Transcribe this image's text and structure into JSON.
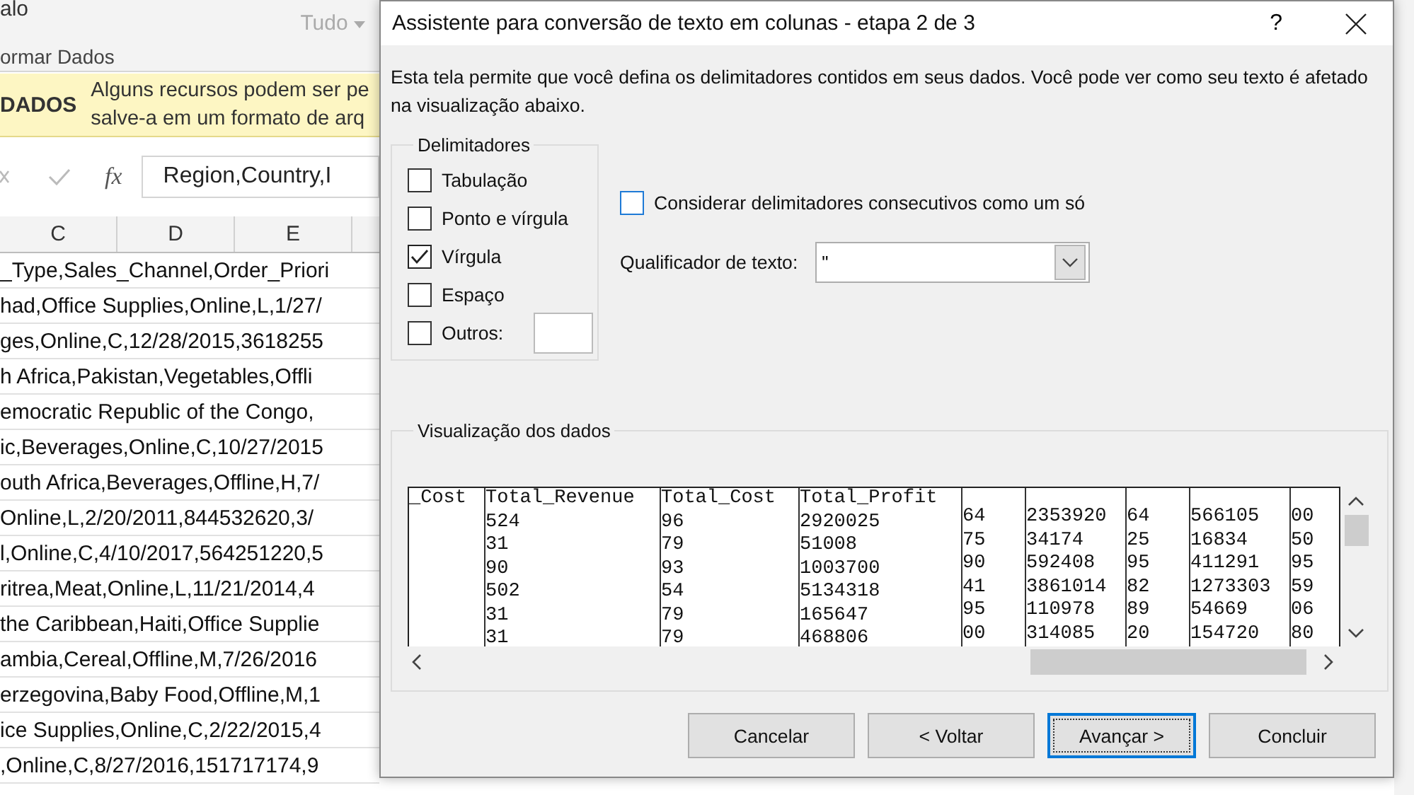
{
  "excel": {
    "ribbon": {
      "command": "alo",
      "refresh_button": "Tudo",
      "refresh_disabled": true,
      "group_label": "ormar Dados"
    },
    "message_bar": {
      "title": "DADOS",
      "lines": [
        "Alguns recursos podem ser pe",
        "salve-a em um formato de arq"
      ]
    },
    "formula_bar": {
      "fx": "fx",
      "value": "Region,Country,I"
    },
    "column_headers": [
      "C",
      "D",
      "E"
    ],
    "rows": [
      "_Type,Sales_Channel,Order_Priori",
      "had,Office Supplies,Online,L,1/27/",
      "ges,Online,C,12/28/2015,3618255",
      "h Africa,Pakistan,Vegetables,Offli",
      "emocratic Republic of the Congo,",
      "ic,Beverages,Online,C,10/27/2015",
      "outh Africa,Beverages,Offline,H,7/",
      "Online,L,2/20/2011,844532620,3/",
      "l,Online,C,4/10/2017,564251220,5",
      "ritrea,Meat,Online,L,11/21/2014,4",
      "the Caribbean,Haiti,Office Supplie",
      "ambia,Cereal,Offline,M,7/26/2016",
      "erzegovina,Baby Food,Offline,M,1",
      "ice Supplies,Online,C,2/22/2015,4",
      ",Online,C,8/27/2016,151717174,9"
    ]
  },
  "dialog": {
    "title": "Assistente para conversão de texto em colunas - etapa 2 de 3",
    "help": "?",
    "description": "Esta tela permite que você defina os delimitadores contidos em seus dados. Você pode ver como seu texto é afetado na visualização abaixo.",
    "delimiters": {
      "title": "Delimitadores",
      "options": [
        {
          "label": "Tabulação",
          "checked": false
        },
        {
          "label": "Ponto e vírgula",
          "checked": false
        },
        {
          "label": "Vírgula",
          "checked": true
        },
        {
          "label": "Espaço",
          "checked": false
        },
        {
          "label": "Outros:",
          "checked": false
        }
      ]
    },
    "consecutive": {
      "label": "Considerar delimitadores consecutivos como um só",
      "checked": false
    },
    "qualifier": {
      "label": "Qualificador de texto:",
      "value": "\""
    },
    "preview": {
      "title": "Visualização dos dados",
      "columns": [
        {
          "header": "_Cost"
        },
        {
          "header": "Total_Revenue",
          "cells": [
            "524",
            "31",
            "90",
            "502",
            "31",
            "31"
          ]
        },
        {
          "header": "Total_Cost",
          "cells": [
            "96",
            "79",
            "93",
            "54",
            "79",
            "79"
          ]
        },
        {
          "header": "Total_Profit",
          "cells": [
            "2920025",
            "51008",
            "1003700",
            "5134318",
            "165647",
            "468806"
          ]
        },
        {
          "cells": [
            "64",
            "75",
            "90",
            "41",
            "95",
            "00"
          ]
        },
        {
          "cells": [
            "2353920",
            "34174",
            "592408",
            "3861014",
            "110978",
            "314085"
          ]
        },
        {
          "cells": [
            "64",
            "25",
            "95",
            "82",
            "89",
            "20"
          ]
        },
        {
          "cells": [
            "566105",
            "16834",
            "411291",
            "1273303",
            "54669",
            "154720"
          ]
        },
        {
          "cells": [
            "00",
            "50",
            "95",
            "59",
            "06",
            "80"
          ]
        }
      ]
    },
    "buttons": [
      {
        "label": "Cancelar",
        "default": false
      },
      {
        "label": "< Voltar",
        "default": false
      },
      {
        "label": "Avançar >",
        "default": true
      },
      {
        "label": "Concluir",
        "default": false
      }
    ]
  }
}
